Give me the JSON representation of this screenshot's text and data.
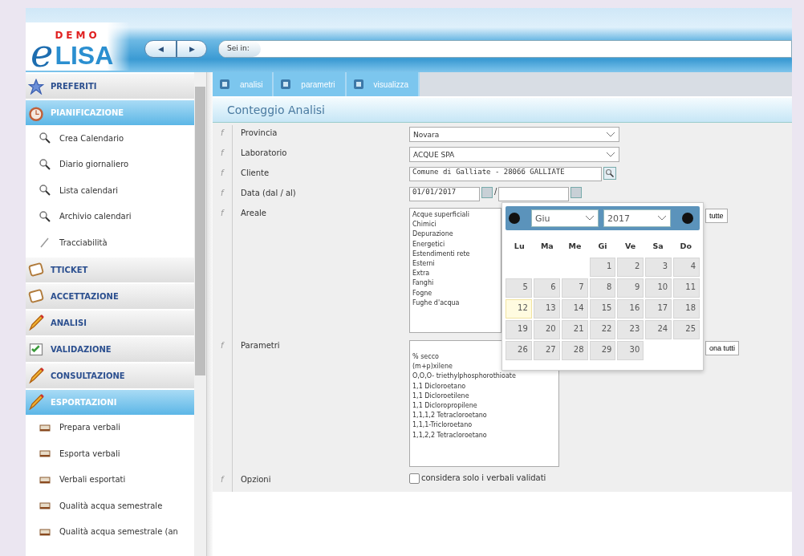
{
  "header": {
    "logo_badge": "DEMO",
    "logo_letter": "e",
    "logo_name": "LISA",
    "nav_back": "◀",
    "nav_forward": "▶",
    "breadcrumb_label": "Sei in:"
  },
  "sidebar": {
    "sections": [
      {
        "label": "PREFERITI",
        "selected": false
      },
      {
        "label": "PIANIFICAZIONE",
        "selected": true,
        "children": [
          {
            "label": "Crea Calendario"
          },
          {
            "label": "Diario giornaliero"
          },
          {
            "label": "Lista calendari"
          },
          {
            "label": "Archivio calendari"
          },
          {
            "label": "Tracciabilità"
          }
        ]
      },
      {
        "label": "TTICKET",
        "selected": false
      },
      {
        "label": "ACCETTAZIONE",
        "selected": false
      },
      {
        "label": "ANALISI",
        "selected": false
      },
      {
        "label": "VALIDAZIONE",
        "selected": false
      },
      {
        "label": "CONSULTAZIONE",
        "selected": false
      },
      {
        "label": "ESPORTAZIONI",
        "selected": true,
        "children": [
          {
            "label": "Prepara verbali"
          },
          {
            "label": "Esporta verbali"
          },
          {
            "label": "Verbali esportati"
          },
          {
            "label": "Qualità acqua semestrale"
          },
          {
            "label": "Qualità acqua semestrale (an"
          }
        ]
      }
    ]
  },
  "tabs": [
    {
      "label": "analisi"
    },
    {
      "label": "parametri"
    },
    {
      "label": "visualizza"
    }
  ],
  "title": "Conteggio Analisi",
  "form": {
    "rows": [
      {
        "marker": "f",
        "label": "Provincia",
        "kind": "select",
        "value": "Novara"
      },
      {
        "marker": "f",
        "label": "Laboratorio",
        "kind": "select",
        "value": "ACQUE SPA"
      },
      {
        "marker": "f",
        "label": "Cliente",
        "kind": "lookup",
        "value": "Comune di Galliate - 28066 GALLIATE"
      },
      {
        "marker": "f",
        "label": "Data (dal / al)",
        "kind": "daterange",
        "value": "01/01/2017",
        "separator": "/"
      },
      {
        "marker": "f",
        "label": "Areale",
        "kind": "list",
        "options": [
          "Acque superficiali",
          "Chimici",
          "Depurazione",
          "Energetici",
          "Estendimenti rete",
          "Esterni",
          "Extra",
          "Fanghi",
          "Fogne",
          "Fughe d'acqua"
        ],
        "button": "tutte"
      },
      {
        "marker": "f",
        "label": "Parametri",
        "kind": "list",
        "options": [
          "% secco",
          "(m+p)xilene",
          "O,O,O- triethylphosphorothioate",
          "1,1 Dicloroetano",
          "1,1 Dicloroetilene",
          "1,1 Dicloropropilene",
          "1,1,1,2 Tetracloroetano",
          "1,1,1-Tricloroetano",
          "1,1,2,2 Tetracloroetano"
        ],
        "button": "ona tutti"
      },
      {
        "marker": "f",
        "label": "Opzioni",
        "kind": "checkbox",
        "checked": false,
        "text": "considera solo i verbali validati"
      }
    ]
  },
  "calendar": {
    "month": "Giu",
    "year": "2017",
    "weekdays": [
      "Lu",
      "Ma",
      "Me",
      "Gi",
      "Ve",
      "Sa",
      "Do"
    ],
    "weeks": [
      [
        {
          "day": "1",
          "today": false
        },
        {
          "day": "2",
          "today": false
        },
        {
          "day": "3",
          "today": false
        },
        {
          "day": "4",
          "today": false
        }
      ],
      [
        {
          "day": "5",
          "today": false
        },
        {
          "day": "6",
          "today": false
        },
        {
          "day": "7",
          "today": false
        },
        {
          "day": "8",
          "today": false
        },
        {
          "day": "9",
          "today": false
        },
        {
          "day": "10",
          "today": false
        },
        {
          "day": "11",
          "today": false
        }
      ],
      [
        {
          "day": "12",
          "today": true
        },
        {
          "day": "13",
          "today": false
        },
        {
          "day": "14",
          "today": false
        },
        {
          "day": "15",
          "today": false
        },
        {
          "day": "16",
          "today": false
        },
        {
          "day": "17",
          "today": false
        },
        {
          "day": "18",
          "today": false
        }
      ],
      [
        {
          "day": "19",
          "today": false
        },
        {
          "day": "20",
          "today": false
        },
        {
          "day": "21",
          "today": false
        },
        {
          "day": "22",
          "today": false
        },
        {
          "day": "23",
          "today": false
        },
        {
          "day": "24",
          "today": false
        },
        {
          "day": "25",
          "today": false
        }
      ],
      [
        {
          "day": "26",
          "today": false
        },
        {
          "day": "27",
          "today": false
        },
        {
          "day": "28",
          "today": false
        },
        {
          "day": "29",
          "today": false
        },
        {
          "day": "30",
          "today": false
        }
      ]
    ]
  }
}
